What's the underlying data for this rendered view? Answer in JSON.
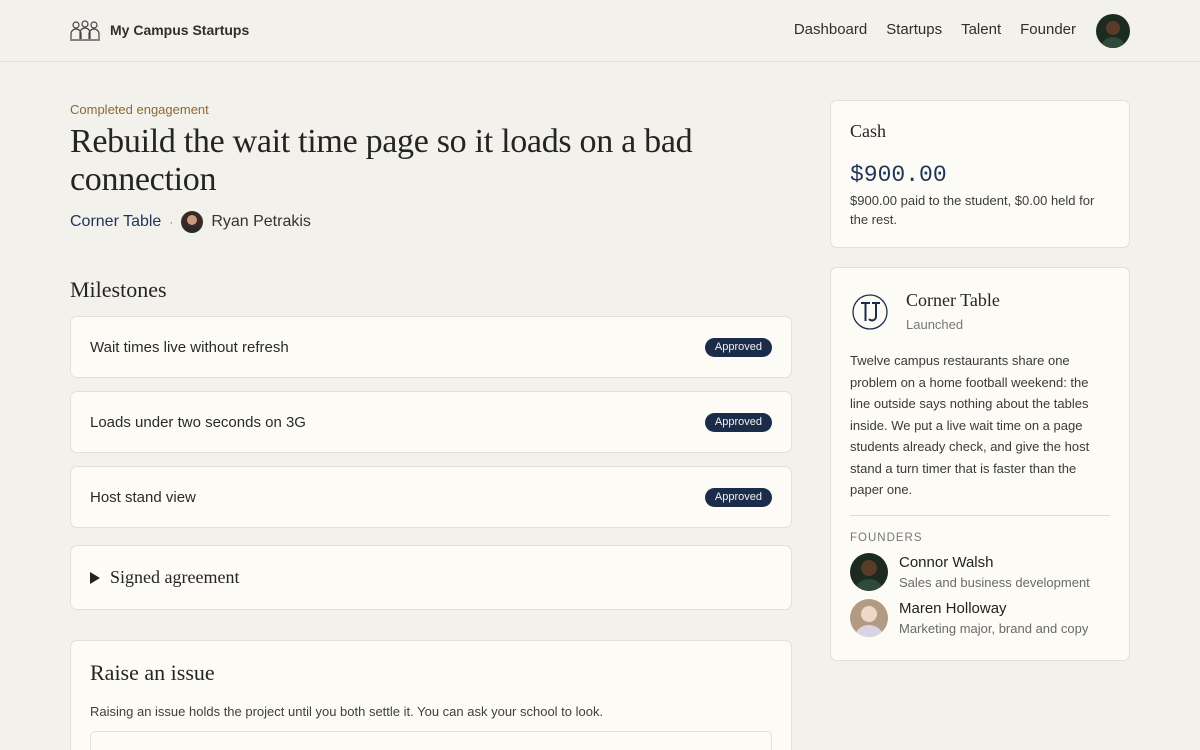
{
  "header": {
    "brand_name": "My Campus Startups",
    "brand_icon": "people-group-icon",
    "nav": [
      "Dashboard",
      "Startups",
      "Talent",
      "Founder"
    ],
    "avatar_icon": "user-avatar"
  },
  "engagement": {
    "status": "Completed engagement",
    "title": "Rebuild the wait time page so it loads on a bad connection",
    "company": "Corner Table",
    "separator": "·",
    "student": "Ryan Petrakis"
  },
  "milestones": {
    "heading": "Milestones",
    "items": [
      {
        "title": "Wait times live without refresh",
        "status": "Approved"
      },
      {
        "title": "Loads under two seconds on 3G",
        "status": "Approved"
      },
      {
        "title": "Host stand view",
        "status": "Approved"
      }
    ]
  },
  "agreement": {
    "label": "Signed agreement"
  },
  "issue": {
    "heading": "Raise an issue",
    "description": "Raising an issue holds the project until you both settle it. You can ask your school to look."
  },
  "cash": {
    "heading": "Cash",
    "amount": "$900.00",
    "note": "$900.00 paid to the student, $0.00 held for the rest."
  },
  "company_card": {
    "logo_icon": "ct-monogram-logo",
    "name": "Corner Table",
    "status": "Launched",
    "description": "Twelve campus restaurants share one problem on a home football weekend: the line outside says nothing about the tables inside. We put a live wait time on a page students already check, and give the host stand a turn timer that is faster than the paper one.",
    "founders_heading": "FOUNDERS",
    "founders": [
      {
        "name": "Connor Walsh",
        "role": "Sales and business development"
      },
      {
        "name": "Maren Holloway",
        "role": "Marketing major, brand and copy"
      }
    ]
  },
  "colors": {
    "background": "#f3f1ec",
    "card": "#fcfbf6",
    "badge": "#1b2b4a",
    "accent_link": "#1f3558",
    "eyebrow": "#8a6a35"
  }
}
